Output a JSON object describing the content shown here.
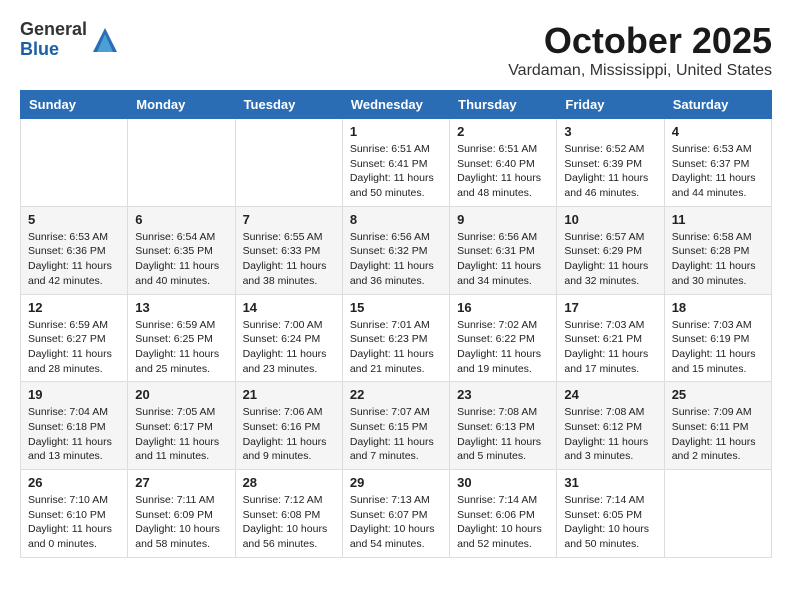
{
  "logo": {
    "general": "General",
    "blue": "Blue"
  },
  "title": "October 2025",
  "location": "Vardaman, Mississippi, United States",
  "days_of_week": [
    "Sunday",
    "Monday",
    "Tuesday",
    "Wednesday",
    "Thursday",
    "Friday",
    "Saturday"
  ],
  "weeks": [
    [
      {
        "day": "",
        "info": ""
      },
      {
        "day": "",
        "info": ""
      },
      {
        "day": "",
        "info": ""
      },
      {
        "day": "1",
        "info": "Sunrise: 6:51 AM\nSunset: 6:41 PM\nDaylight: 11 hours\nand 50 minutes."
      },
      {
        "day": "2",
        "info": "Sunrise: 6:51 AM\nSunset: 6:40 PM\nDaylight: 11 hours\nand 48 minutes."
      },
      {
        "day": "3",
        "info": "Sunrise: 6:52 AM\nSunset: 6:39 PM\nDaylight: 11 hours\nand 46 minutes."
      },
      {
        "day": "4",
        "info": "Sunrise: 6:53 AM\nSunset: 6:37 PM\nDaylight: 11 hours\nand 44 minutes."
      }
    ],
    [
      {
        "day": "5",
        "info": "Sunrise: 6:53 AM\nSunset: 6:36 PM\nDaylight: 11 hours\nand 42 minutes."
      },
      {
        "day": "6",
        "info": "Sunrise: 6:54 AM\nSunset: 6:35 PM\nDaylight: 11 hours\nand 40 minutes."
      },
      {
        "day": "7",
        "info": "Sunrise: 6:55 AM\nSunset: 6:33 PM\nDaylight: 11 hours\nand 38 minutes."
      },
      {
        "day": "8",
        "info": "Sunrise: 6:56 AM\nSunset: 6:32 PM\nDaylight: 11 hours\nand 36 minutes."
      },
      {
        "day": "9",
        "info": "Sunrise: 6:56 AM\nSunset: 6:31 PM\nDaylight: 11 hours\nand 34 minutes."
      },
      {
        "day": "10",
        "info": "Sunrise: 6:57 AM\nSunset: 6:29 PM\nDaylight: 11 hours\nand 32 minutes."
      },
      {
        "day": "11",
        "info": "Sunrise: 6:58 AM\nSunset: 6:28 PM\nDaylight: 11 hours\nand 30 minutes."
      }
    ],
    [
      {
        "day": "12",
        "info": "Sunrise: 6:59 AM\nSunset: 6:27 PM\nDaylight: 11 hours\nand 28 minutes."
      },
      {
        "day": "13",
        "info": "Sunrise: 6:59 AM\nSunset: 6:25 PM\nDaylight: 11 hours\nand 25 minutes."
      },
      {
        "day": "14",
        "info": "Sunrise: 7:00 AM\nSunset: 6:24 PM\nDaylight: 11 hours\nand 23 minutes."
      },
      {
        "day": "15",
        "info": "Sunrise: 7:01 AM\nSunset: 6:23 PM\nDaylight: 11 hours\nand 21 minutes."
      },
      {
        "day": "16",
        "info": "Sunrise: 7:02 AM\nSunset: 6:22 PM\nDaylight: 11 hours\nand 19 minutes."
      },
      {
        "day": "17",
        "info": "Sunrise: 7:03 AM\nSunset: 6:21 PM\nDaylight: 11 hours\nand 17 minutes."
      },
      {
        "day": "18",
        "info": "Sunrise: 7:03 AM\nSunset: 6:19 PM\nDaylight: 11 hours\nand 15 minutes."
      }
    ],
    [
      {
        "day": "19",
        "info": "Sunrise: 7:04 AM\nSunset: 6:18 PM\nDaylight: 11 hours\nand 13 minutes."
      },
      {
        "day": "20",
        "info": "Sunrise: 7:05 AM\nSunset: 6:17 PM\nDaylight: 11 hours\nand 11 minutes."
      },
      {
        "day": "21",
        "info": "Sunrise: 7:06 AM\nSunset: 6:16 PM\nDaylight: 11 hours\nand 9 minutes."
      },
      {
        "day": "22",
        "info": "Sunrise: 7:07 AM\nSunset: 6:15 PM\nDaylight: 11 hours\nand 7 minutes."
      },
      {
        "day": "23",
        "info": "Sunrise: 7:08 AM\nSunset: 6:13 PM\nDaylight: 11 hours\nand 5 minutes."
      },
      {
        "day": "24",
        "info": "Sunrise: 7:08 AM\nSunset: 6:12 PM\nDaylight: 11 hours\nand 3 minutes."
      },
      {
        "day": "25",
        "info": "Sunrise: 7:09 AM\nSunset: 6:11 PM\nDaylight: 11 hours\nand 2 minutes."
      }
    ],
    [
      {
        "day": "26",
        "info": "Sunrise: 7:10 AM\nSunset: 6:10 PM\nDaylight: 11 hours\nand 0 minutes."
      },
      {
        "day": "27",
        "info": "Sunrise: 7:11 AM\nSunset: 6:09 PM\nDaylight: 10 hours\nand 58 minutes."
      },
      {
        "day": "28",
        "info": "Sunrise: 7:12 AM\nSunset: 6:08 PM\nDaylight: 10 hours\nand 56 minutes."
      },
      {
        "day": "29",
        "info": "Sunrise: 7:13 AM\nSunset: 6:07 PM\nDaylight: 10 hours\nand 54 minutes."
      },
      {
        "day": "30",
        "info": "Sunrise: 7:14 AM\nSunset: 6:06 PM\nDaylight: 10 hours\nand 52 minutes."
      },
      {
        "day": "31",
        "info": "Sunrise: 7:14 AM\nSunset: 6:05 PM\nDaylight: 10 hours\nand 50 minutes."
      },
      {
        "day": "",
        "info": ""
      }
    ]
  ]
}
